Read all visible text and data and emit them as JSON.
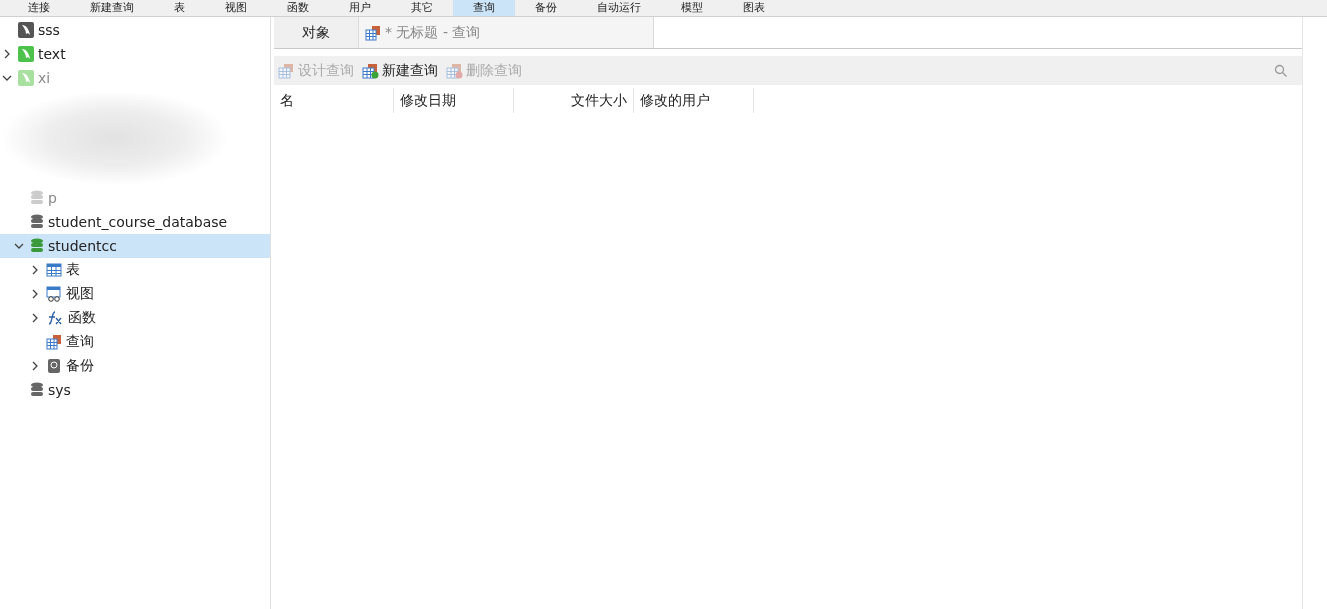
{
  "toolbar": [
    {
      "label": "连接",
      "selected": false
    },
    {
      "label": "新建查询",
      "selected": false
    },
    {
      "label": "表",
      "selected": false
    },
    {
      "label": "视图",
      "selected": false
    },
    {
      "label": "函数",
      "selected": false
    },
    {
      "label": "用户",
      "selected": false
    },
    {
      "label": "其它",
      "selected": false
    },
    {
      "label": "查询",
      "selected": true
    },
    {
      "label": "备份",
      "selected": false
    },
    {
      "label": "自动运行",
      "selected": false
    },
    {
      "label": "模型",
      "selected": false
    },
    {
      "label": "图表",
      "selected": false
    }
  ],
  "sidebar": {
    "items": [
      {
        "kind": "connection",
        "label": "sss",
        "active": false,
        "dimmed": false,
        "selected": false
      },
      {
        "kind": "connection",
        "label": "text",
        "active": true,
        "dimmed": false,
        "selected": false
      },
      {
        "kind": "connection",
        "label": "xi",
        "active": true,
        "dimmed": true,
        "expanded": true,
        "selected": false,
        "children": [
          {
            "kind": "database",
            "label": "p",
            "active": false,
            "dimmed": true,
            "selected": false
          },
          {
            "kind": "database",
            "label": "student_course_database",
            "active": false,
            "dimmed": false,
            "selected": false
          },
          {
            "kind": "database",
            "label": "studentcc",
            "active": true,
            "dimmed": false,
            "expanded": true,
            "selected": true,
            "children": [
              {
                "kind": "tables",
                "label": "表",
                "expandable": true,
                "dimmed": false,
                "selected": false
              },
              {
                "kind": "views",
                "label": "视图",
                "expandable": true,
                "dimmed": false,
                "selected": false
              },
              {
                "kind": "functions",
                "label": "函数",
                "expandable": true,
                "dimmed": false,
                "selected": false
              },
              {
                "kind": "queries",
                "label": "查询",
                "expandable": false,
                "dimmed": false,
                "selected": false
              },
              {
                "kind": "backups",
                "label": "备份",
                "expandable": true,
                "dimmed": false,
                "selected": false
              }
            ]
          },
          {
            "kind": "database",
            "label": "sys",
            "active": false,
            "dimmed": false,
            "selected": false
          }
        ]
      }
    ]
  },
  "tabs": [
    {
      "label": "对象",
      "kind": "plain",
      "selected": true
    },
    {
      "label": "* 无标题 - 查询",
      "kind": "query",
      "selected": false
    }
  ],
  "actions": [
    {
      "label": "设计查询",
      "kind": "design",
      "disabled": true
    },
    {
      "label": "新建查询",
      "kind": "new",
      "disabled": false
    },
    {
      "label": "删除查询",
      "kind": "delete",
      "disabled": true
    }
  ],
  "table": {
    "columns": [
      {
        "label": "名",
        "kind": "text"
      },
      {
        "label": "修改日期",
        "kind": "text"
      },
      {
        "label": "文件大小",
        "kind": "size"
      },
      {
        "label": "修改的用户",
        "kind": "text"
      }
    ]
  }
}
